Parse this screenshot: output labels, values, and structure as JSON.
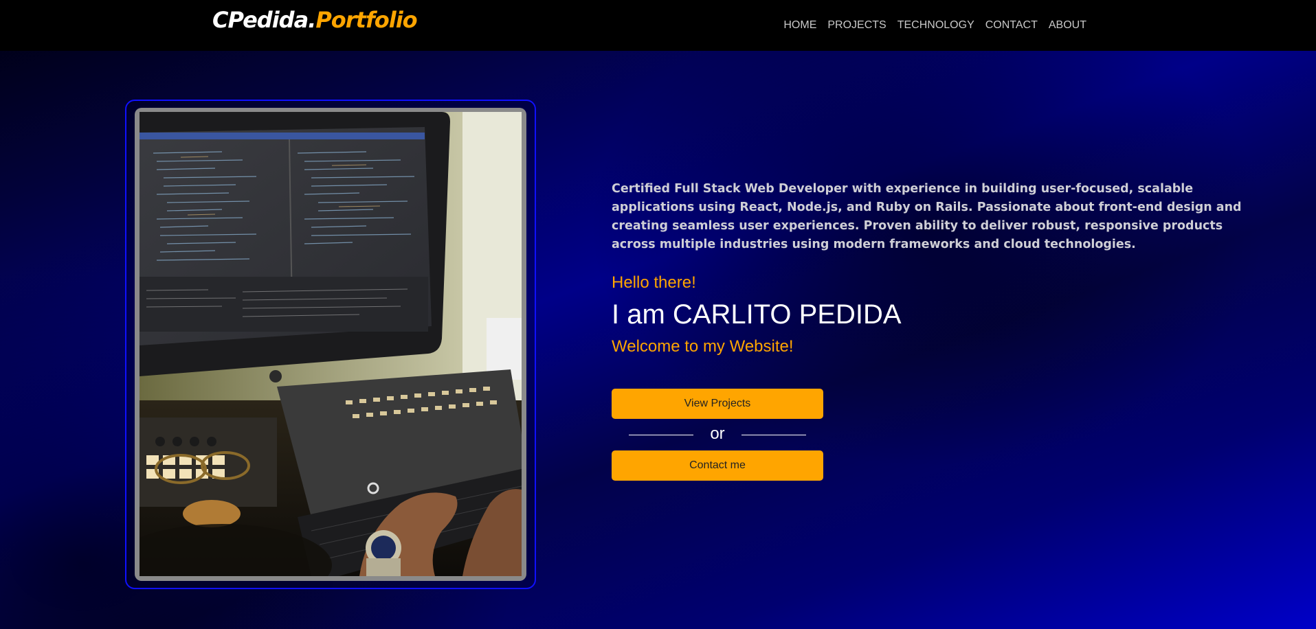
{
  "brand": {
    "part1": "CPedida.",
    "part2": "Portfolio"
  },
  "nav": {
    "items": [
      {
        "label": "HOME"
      },
      {
        "label": "PROJECTS"
      },
      {
        "label": "TECHNOLOGY"
      },
      {
        "label": "CONTACT"
      },
      {
        "label": "ABOUT"
      }
    ]
  },
  "hero": {
    "bio": "Certified Full Stack Web Developer with experience in building user-focused, scalable applications using React, Node.js, and Ruby on Rails. Passionate about front-end design and creating seamless user experiences. Proven ability to deliver robust, responsive products across multiple industries using modern frameworks and cloud technologies.",
    "greeting": "Hello there!",
    "name": "I am CARLITO PEDIDA",
    "welcome": "Welcome to my Website!",
    "view_projects_label": "View Projects",
    "or_label": "or",
    "contact_label": "Contact me"
  },
  "colors": {
    "accent": "#ffa500",
    "navbar_bg": "#000000",
    "frame_border": "#1010ff",
    "text_light": "#cfcfd6"
  }
}
